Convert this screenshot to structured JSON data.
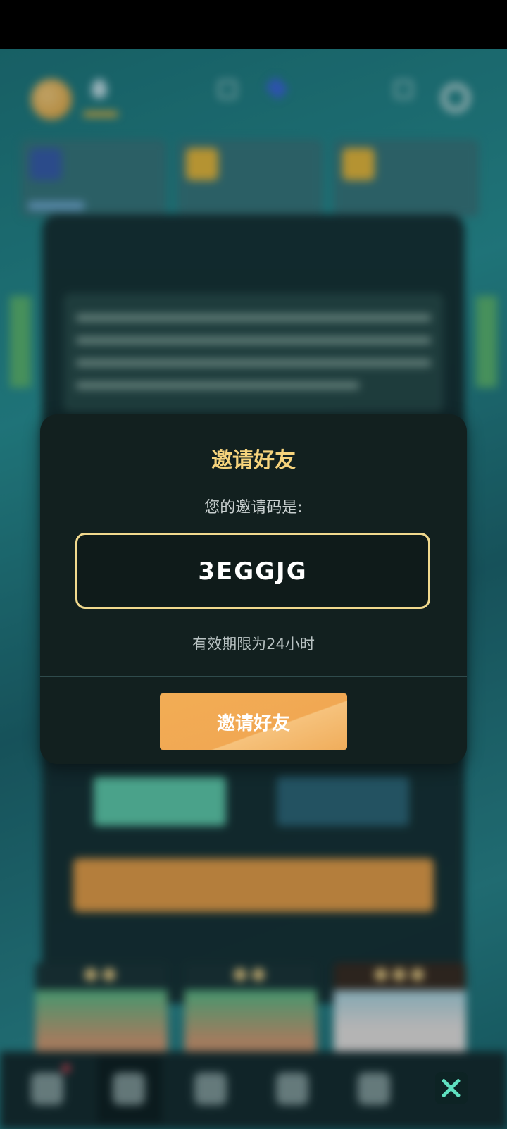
{
  "dialog": {
    "title": "邀请好友",
    "subtitle": "您的邀请码是:",
    "invite_code": "3EGGJG",
    "validity_text": "有效期限为24小时",
    "invite_button_label": "邀请好友"
  },
  "icons": {
    "close": "close-x-icon"
  },
  "colors": {
    "dialog_background": "#12201f",
    "title_gold": "#f6d37c",
    "code_border": "#f1d98e",
    "button_orange": "#f2ad55",
    "close_icon_teal": "#5fe0c0"
  }
}
